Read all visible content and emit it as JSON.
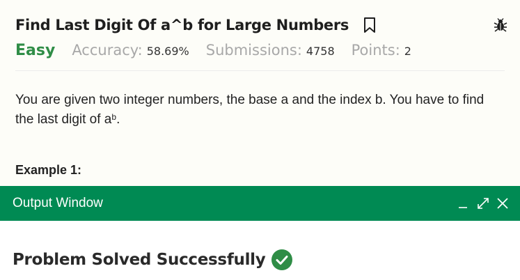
{
  "problem": {
    "title": "Find Last Digit Of a^b for Large Numbers",
    "difficulty": "Easy",
    "accuracy_label": "Accuracy:",
    "accuracy_value": "58.69%",
    "submissions_label": "Submissions:",
    "submissions_value": "4758",
    "points_label": "Points:",
    "points_value": "2",
    "description_part1": "You are given two integer numbers, the base a and the index b. You have to find the last digit of a",
    "description_sup": "b",
    "description_part2": ".",
    "example_heading": "Example 1:"
  },
  "output_window": {
    "title": "Output Window",
    "status": "Problem Solved Successfully"
  },
  "icons": {
    "bookmark": "bookmark-icon",
    "bug": "bug-icon",
    "minimize": "minimize-icon",
    "expand": "expand-icon",
    "close": "close-icon",
    "success": "check-circle-icon"
  },
  "colors": {
    "accent_green": "#2f8d46",
    "header_green": "#008a53",
    "success_green": "#2f8d46",
    "muted_gray": "#a8a8a8"
  }
}
